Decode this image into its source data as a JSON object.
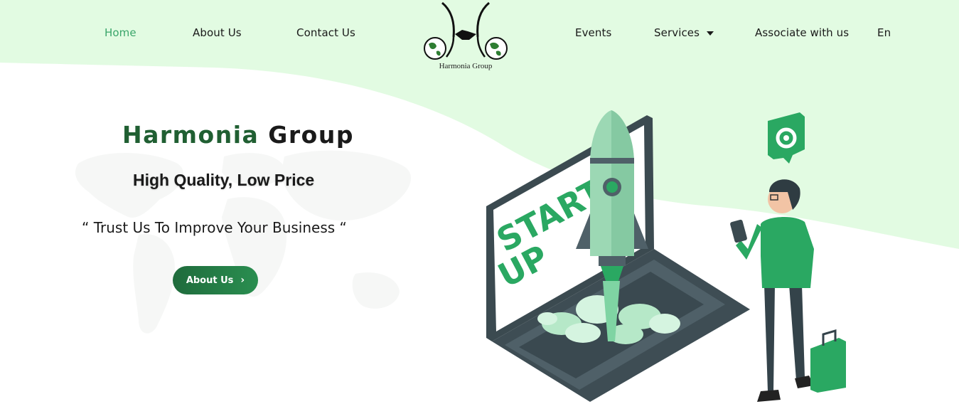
{
  "nav": {
    "home": "Home",
    "about": "About Us",
    "contact": "Contact Us",
    "events": "Events",
    "services": "Services",
    "associate": "Associate with us",
    "lang": "En"
  },
  "logo": {
    "text": "Harmonia Group"
  },
  "hero": {
    "title_part1": "Harmonia",
    "title_part2": "Group",
    "subtitle": "High Quality, Low Price",
    "quote": "“ Trust Us To Improve Your  Business “",
    "button_label": "About Us"
  },
  "illustration": {
    "screen_text_line1": "START",
    "screen_text_line2": "UP"
  },
  "colors": {
    "accent_green": "#3aa56a",
    "dark_green": "#205f32",
    "wave_bg": "#e2fbe2"
  }
}
